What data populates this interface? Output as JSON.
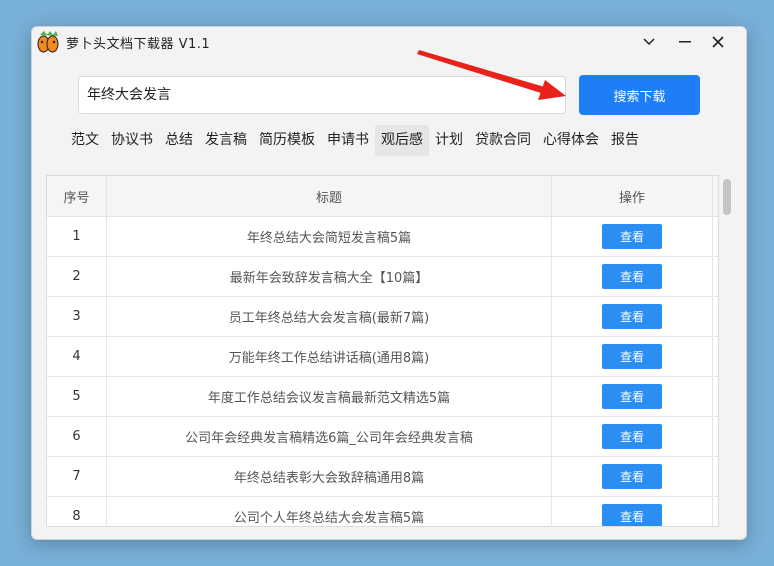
{
  "app": {
    "title": "萝卜头文档下载器  V1.1"
  },
  "window_controls": {
    "minimize": "⌄",
    "maximize": "—",
    "close": "✕"
  },
  "search": {
    "value": "年终大会发言",
    "button": "搜索下载"
  },
  "tabs": [
    {
      "label": "范文"
    },
    {
      "label": "协议书"
    },
    {
      "label": "总结"
    },
    {
      "label": "发言稿"
    },
    {
      "label": "简历模板"
    },
    {
      "label": "申请书"
    },
    {
      "label": "观后感"
    },
    {
      "label": "计划"
    },
    {
      "label": "贷款合同"
    },
    {
      "label": "心得体会"
    },
    {
      "label": "报告"
    }
  ],
  "table": {
    "headers": [
      "序号",
      "标题",
      "操作"
    ],
    "action_label": "查看",
    "rows": [
      {
        "index": "1",
        "title": "年终总结大会简短发言稿5篇"
      },
      {
        "index": "2",
        "title": "最新年会致辞发言稿大全【10篇】"
      },
      {
        "index": "3",
        "title": "员工年终总结大会发言稿(最新7篇)"
      },
      {
        "index": "4",
        "title": "万能年终工作总结讲话稿(通用8篇)"
      },
      {
        "index": "5",
        "title": "年度工作总结会议发言稿最新范文精选5篇"
      },
      {
        "index": "6",
        "title": "公司年会经典发言稿精选6篇_公司年会经典发言稿"
      },
      {
        "index": "7",
        "title": "年终总结表彰大会致辞稿通用8篇"
      },
      {
        "index": "8",
        "title": "公司个人年终总结大会发言稿5篇"
      }
    ]
  },
  "colors": {
    "accent": "#1e7ef7",
    "button": "#2b8ff2",
    "arrow": "#e8221a"
  }
}
